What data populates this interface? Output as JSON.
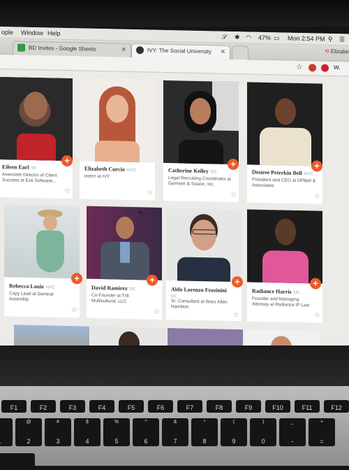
{
  "menubar": {
    "items": [
      "ople",
      "Window",
      "Help"
    ],
    "battery": "47%",
    "clock": "Mon 2:54 PM"
  },
  "tabs": [
    {
      "label": "BD Invites - Google Sheets",
      "color": "#2e9b4a"
    },
    {
      "label": "IVY: The Social University",
      "color": "#333333"
    }
  ],
  "profile": "Elizabe",
  "toolbar_ext": "W.",
  "cards": [
    {
      "name": "Eileen Earl",
      "loc": "SF",
      "role": "Associate Director of Client Success at Eze Software..."
    },
    {
      "name": "Elizabeth Curcio",
      "loc": "NYC",
      "role": "Intern at IVY"
    },
    {
      "name": "Catherine Kelley",
      "loc": "DC",
      "role": "Legal Recruiting Coordinator at Garrison & Sisson, Inc."
    },
    {
      "name": "Desiree Peterkin Bell",
      "loc": "NYC",
      "role": "President and CEO at DPBell & Associates"
    },
    {
      "name": "Rebecca Louie",
      "loc": "NYC",
      "role": "Copy Lead at General Assembly"
    },
    {
      "name": "David Ramirez",
      "loc": "DC",
      "role": "Co-Founder at Trill Multicultural, LLC"
    },
    {
      "name": "Aldo Lorenzo Frosinini",
      "loc": "DC",
      "role": "Sr. Consultant at Booz Allen Hamilton"
    },
    {
      "name": "Radiance Harris",
      "loc": "DC",
      "role": "Founder and Managing Attorney at Radiance IP Law"
    }
  ],
  "colors": {
    "accent": "#ef5a2a",
    "page_bg": "#ecebe7"
  },
  "keyboard": {
    "fn_row": [
      "F1",
      "F2",
      "F3",
      "F4",
      "F5",
      "F6",
      "F7",
      "F8",
      "F9",
      "F10",
      "F11",
      "F12"
    ],
    "num_row": [
      {
        "top": "!",
        "bottom": "1"
      },
      {
        "top": "@",
        "bottom": "2"
      },
      {
        "top": "#",
        "bottom": "3"
      },
      {
        "top": "$",
        "bottom": "4"
      },
      {
        "top": "%",
        "bottom": "5"
      },
      {
        "top": "^",
        "bottom": "6"
      },
      {
        "top": "&",
        "bottom": "7"
      },
      {
        "top": "*",
        "bottom": "8"
      },
      {
        "top": "(",
        "bottom": "9"
      },
      {
        "top": ")",
        "bottom": "0"
      },
      {
        "top": "_",
        "bottom": "-"
      },
      {
        "top": "+",
        "bottom": "="
      }
    ]
  }
}
